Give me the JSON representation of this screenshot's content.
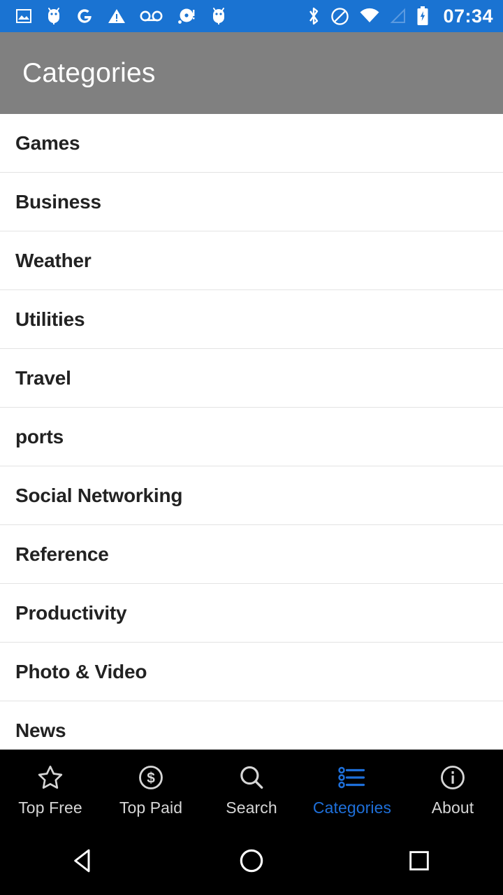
{
  "status_bar": {
    "background_color": "#1a73d2",
    "time": "07:34",
    "left_icons": [
      {
        "name": "image-icon"
      },
      {
        "name": "android-bug-icon"
      },
      {
        "name": "google-g-icon"
      },
      {
        "name": "warning-triangle-icon"
      },
      {
        "name": "voicemail-icon"
      },
      {
        "name": "disc-alert-icon"
      },
      {
        "name": "android-bug-icon-2"
      }
    ],
    "right_icons": [
      {
        "name": "bluetooth-icon"
      },
      {
        "name": "do-not-disturb-icon"
      },
      {
        "name": "wifi-icon"
      },
      {
        "name": "cell-signal-icon"
      },
      {
        "name": "battery-charging-icon"
      }
    ]
  },
  "app_bar": {
    "title": "Categories",
    "background_color": "#808080",
    "text_color": "#ffffff"
  },
  "categories": {
    "items": [
      {
        "label": "Games"
      },
      {
        "label": "Business"
      },
      {
        "label": "Weather"
      },
      {
        "label": "Utilities"
      },
      {
        "label": "Travel"
      },
      {
        "label": "ports"
      },
      {
        "label": "Social Networking"
      },
      {
        "label": "Reference"
      },
      {
        "label": "Productivity"
      },
      {
        "label": "Photo & Video"
      },
      {
        "label": "News"
      }
    ]
  },
  "tab_bar": {
    "background_color": "#000000",
    "active_color": "#1e6fd9",
    "inactive_color": "#d6d6d6",
    "tabs": [
      {
        "label": "Top Free",
        "icon": "star-outline-icon",
        "active": false
      },
      {
        "label": "Top Paid",
        "icon": "dollar-circle-icon",
        "active": false
      },
      {
        "label": "Search",
        "icon": "search-icon",
        "active": false
      },
      {
        "label": "Categories",
        "icon": "list-bullet-icon",
        "active": true
      },
      {
        "label": "About",
        "icon": "info-circle-icon",
        "active": false
      }
    ]
  },
  "nav_bar": {
    "background_color": "#000000",
    "buttons": [
      {
        "name": "back-button",
        "icon": "triangle-left-icon"
      },
      {
        "name": "home-button",
        "icon": "circle-icon"
      },
      {
        "name": "recents-button",
        "icon": "square-icon"
      }
    ]
  }
}
